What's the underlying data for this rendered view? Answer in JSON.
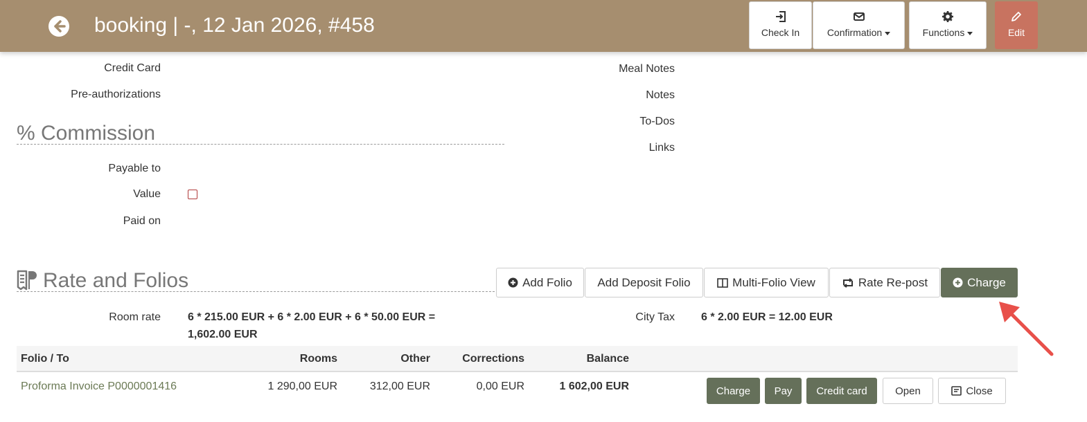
{
  "header": {
    "title": "booking | -, 12 Jan 2026, #458",
    "buttons": {
      "check_in": "Check In",
      "confirmation": "Confirmation",
      "functions": "Functions",
      "edit": "Edit"
    }
  },
  "left_fields": {
    "credit_card": "Credit Card",
    "pre_authorizations": "Pre-authorizations"
  },
  "commission": {
    "title": "% Commission",
    "payable_to": "Payable to",
    "value": "Value",
    "paid_on": "Paid on"
  },
  "right_fields": {
    "meal_notes": "Meal Notes",
    "notes": "Notes",
    "todos": "To-Dos",
    "links": "Links"
  },
  "rates": {
    "title": "Rate and Folios",
    "buttons": {
      "add_folio": "Add Folio",
      "add_deposit_folio": "Add Deposit Folio",
      "multi_folio_view": "Multi-Folio View",
      "rate_repost": "Rate Re-post",
      "charge": "Charge"
    },
    "room_rate_label": "Room rate",
    "room_rate_line1": "6 * 215.00 EUR + 6 * 2.00 EUR + 6 * 50.00 EUR =",
    "room_rate_line2": "1,602.00 EUR",
    "city_tax_label": "City Tax",
    "city_tax_value": "6 * 2.00 EUR = 12.00 EUR"
  },
  "folio_table": {
    "columns": [
      "Folio / To",
      "Rooms",
      "Other",
      "Corrections",
      "Balance"
    ],
    "rows": [
      {
        "folio": "Proforma Invoice P0000001416",
        "rooms": "1 290,00 EUR",
        "other": "312,00 EUR",
        "corrections": "0,00 EUR",
        "balance": "1 602,00 EUR",
        "actions": {
          "charge": "Charge",
          "pay": "Pay",
          "credit_card": "Credit card",
          "open": "Open",
          "close": "Close"
        }
      }
    ]
  },
  "colors": {
    "header_bg": "#a68e6f",
    "edit_button": "#c87360",
    "dark_button": "#65705a",
    "link": "#6b7a55",
    "annotation_arrow": "#e8504a"
  },
  "icons": {
    "back": "circle-arrow-left-icon",
    "check_in": "sign-in-icon",
    "confirmation": "envelope-icon",
    "functions": "gear-icon",
    "edit": "pencil-icon",
    "rates": "receipt-icon",
    "add_folio": "plus-circle-icon",
    "multi_folio": "columns-icon",
    "repost": "retweet-icon",
    "charge": "plus-circle-icon",
    "close": "note-icon"
  }
}
